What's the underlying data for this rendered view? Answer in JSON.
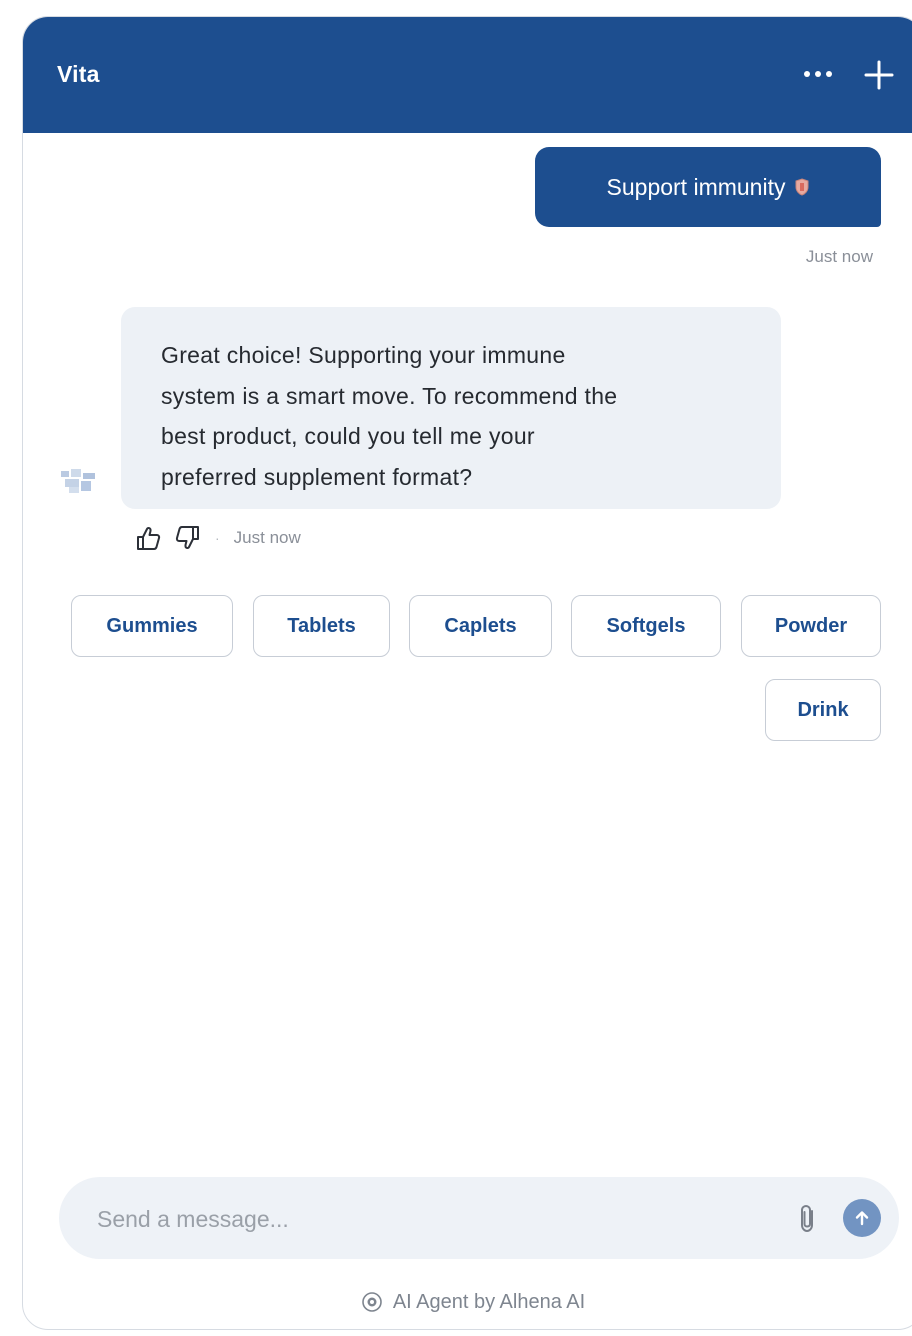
{
  "header": {
    "title": "Vita",
    "more_icon": "ellipsis-icon",
    "new_chat_icon": "plus-icon"
  },
  "messages": {
    "user": {
      "text": "Support immunity",
      "emoji_icon": "shield-icon",
      "time": "Just now"
    },
    "bot": {
      "lines": [
        "Great choice! Supporting your immune",
        "system is a smart move. To recommend the",
        "best product, could you tell me your",
        "preferred supplement format?"
      ],
      "time": "Just now",
      "separator": "·"
    }
  },
  "options": [
    "Gummies",
    "Tablets",
    "Caplets",
    "Softgels",
    "Powder",
    "Drink"
  ],
  "composer": {
    "placeholder": "Send a message...",
    "attach_icon": "paperclip-icon",
    "send_icon": "arrow-up-icon"
  },
  "footer": {
    "text": "AI Agent by Alhena AI",
    "icon": "ai-agent-icon"
  },
  "colors": {
    "brand": "#1d4e8f",
    "bot_bubble": "#edf1f6",
    "send_button": "#7294c2",
    "muted_text": "#8a8f98"
  }
}
